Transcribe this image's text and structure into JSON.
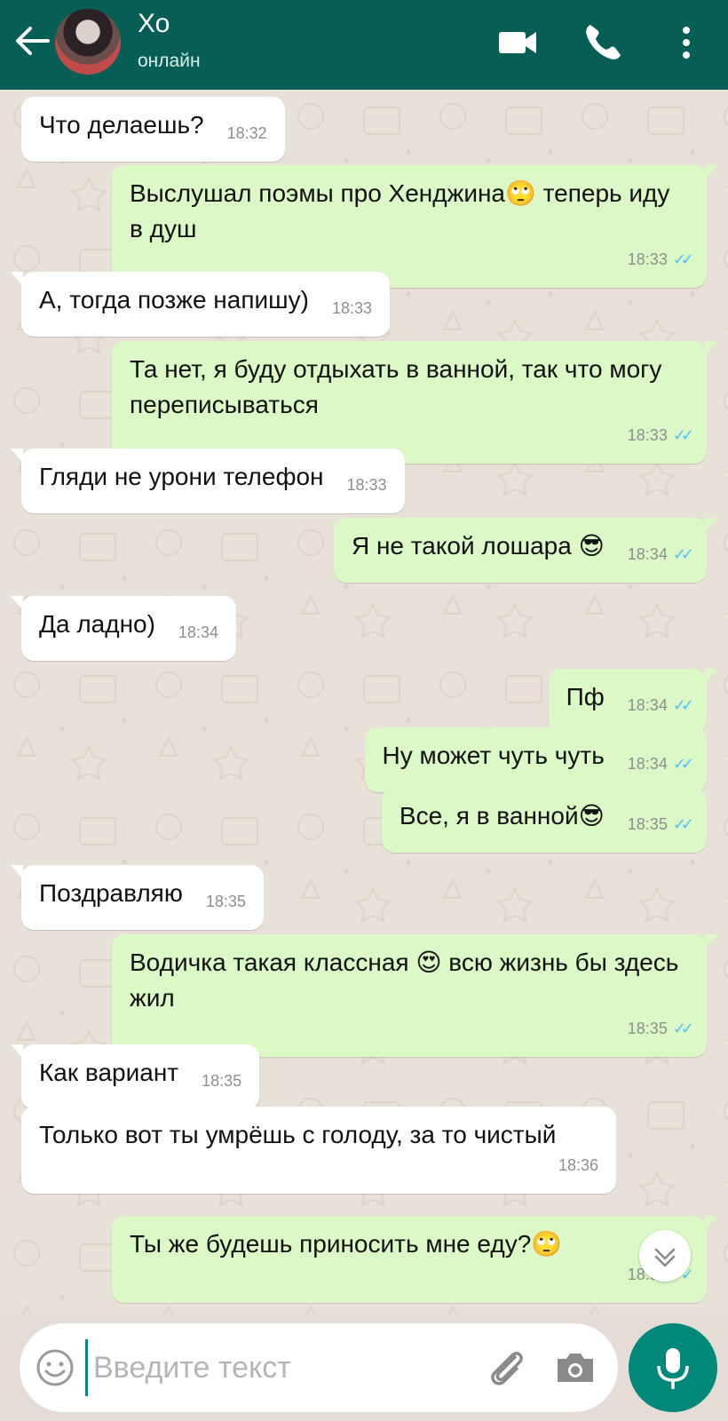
{
  "header": {
    "title": "Хо",
    "subtitle": "онлайн",
    "background": "#075e54"
  },
  "icons": {
    "back": "arrow-left-icon",
    "video": "video-call-icon",
    "call": "phone-icon",
    "menu": "more-vertical-icon",
    "emoji": "emoji-icon",
    "attach": "paperclip-icon",
    "camera": "camera-icon",
    "mic": "microphone-icon",
    "scroll": "chevron-down-icon"
  },
  "messages": [
    {
      "dir": "in",
      "text": "Что делаешь?",
      "time": "18:32"
    },
    {
      "dir": "out",
      "text": "Выслушал поэмы про Хенджина🙄 теперь иду в душ",
      "time": "18:33",
      "ticks": "✓✓"
    },
    {
      "dir": "in",
      "text": "А, тогда позже напишу)",
      "time": "18:33"
    },
    {
      "dir": "out",
      "text": "Та нет, я буду отдыхать в ванной, так что могу переписываться",
      "time": "18:33",
      "ticks": "✓✓"
    },
    {
      "dir": "in",
      "text": "Гляди не урони телефон",
      "time": "18:33"
    },
    {
      "dir": "out",
      "text": "Я не такой лошара 😎",
      "time": "18:34",
      "ticks": "✓✓"
    },
    {
      "dir": "in",
      "text": "Да ладно)",
      "time": "18:34"
    },
    {
      "dir": "out",
      "text": "Пф",
      "time": "18:34",
      "ticks": "✓✓"
    },
    {
      "dir": "out",
      "text": "Ну может чуть чуть",
      "time": "18:34",
      "ticks": "✓✓"
    },
    {
      "dir": "out",
      "text": "Все, я в ванной😎",
      "time": "18:35",
      "ticks": "✓✓"
    },
    {
      "dir": "in",
      "text": "Поздравляю",
      "time": "18:35"
    },
    {
      "dir": "out",
      "text": "Водичка такая классная 😍 всю жизнь бы здесь жил",
      "time": "18:35",
      "ticks": "✓✓"
    },
    {
      "dir": "in",
      "text": "Как вариант",
      "time": "18:35"
    },
    {
      "dir": "in",
      "text": "Только вот ты умрёшь с голоду, за то чистый",
      "time": "18:36"
    },
    {
      "dir": "out",
      "text": "Ты же будешь приносить мне еду?🙄",
      "time": "18:36",
      "ticks": "✓✓"
    }
  ],
  "composer": {
    "placeholder": "Введите текст",
    "value": ""
  },
  "colors": {
    "outgoing_bubble": "#dcf8c6",
    "incoming_bubble": "#ffffff",
    "read_ticks": "#4fc3f7",
    "accent": "#00897b",
    "chat_bg": "#e5ddd5"
  }
}
